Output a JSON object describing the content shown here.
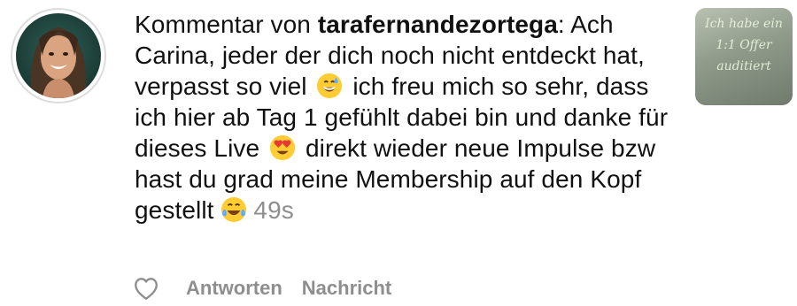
{
  "comment": {
    "prefix": "Kommentar von ",
    "username": "tarafernandezortega",
    "text_part1": ": Ach Carina, jeder der dich noch nicht entdeckt hat, verpasst so viel",
    "text_part2": " ich freu mich so sehr, dass ich hier ab Tag 1 gefühlt dabei bin und danke für dieses Live",
    "text_part3": " direkt wieder neue Impulse bzw hast du grad meine Membership auf den Kopf gestellt",
    "time": "49s"
  },
  "emojis": {
    "first": "grinning-sweat-emoji",
    "second": "heart-eyes-emoji",
    "third": "tears-of-joy-emoji"
  },
  "actions": {
    "reply_label": "Antworten",
    "message_label": "Nachricht"
  },
  "thumbnail": {
    "lines": [
      "Ich habe ein",
      "1:1 Offer",
      "auditiert"
    ]
  }
}
